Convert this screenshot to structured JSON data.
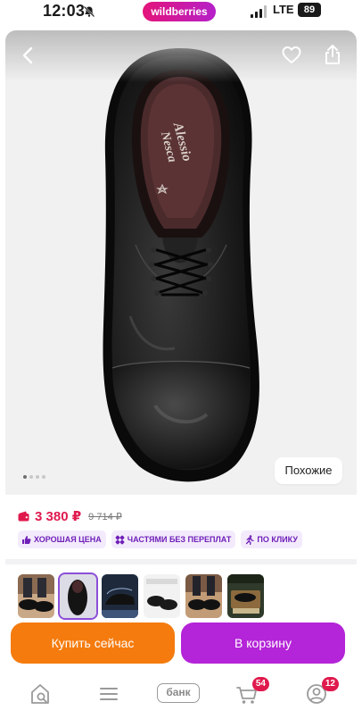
{
  "status_bar": {
    "time": "12:03",
    "brand": "wildberries",
    "network": "LTE",
    "battery": "89"
  },
  "product": {
    "image_brand_text": "Alessio Nesca",
    "price": "3 380 ₽",
    "old_price": "9 714 ₽",
    "similar_label": "Похожие",
    "badges": [
      {
        "label": "ХОРОШАЯ ЦЕНА",
        "icon": "thumbs-up-icon"
      },
      {
        "label": "ЧАСТЯМИ БЕЗ ПЕРЕПЛАТ",
        "icon": "split-payment-icon"
      },
      {
        "label": "ПО КЛИКУ",
        "icon": "runner-icon"
      }
    ],
    "gallery_count": 6,
    "gallery_selected": 2
  },
  "actions": {
    "buy_now": "Купить сейчас",
    "add_to_cart": "В корзину"
  },
  "bottom_nav": {
    "home_icon": "home-search-icon",
    "menu_icon": "menu-icon",
    "bank_label": "банк",
    "cart_badge": "54",
    "profile_badge": "12"
  },
  "colors": {
    "brand_pink": "#e4147a",
    "price_red": "#e0194d",
    "buy_orange": "#f57b0e",
    "cart_purple": "#b424d8",
    "badge_bg": "#f3ebfc",
    "badge_text": "#6f1fb8"
  }
}
